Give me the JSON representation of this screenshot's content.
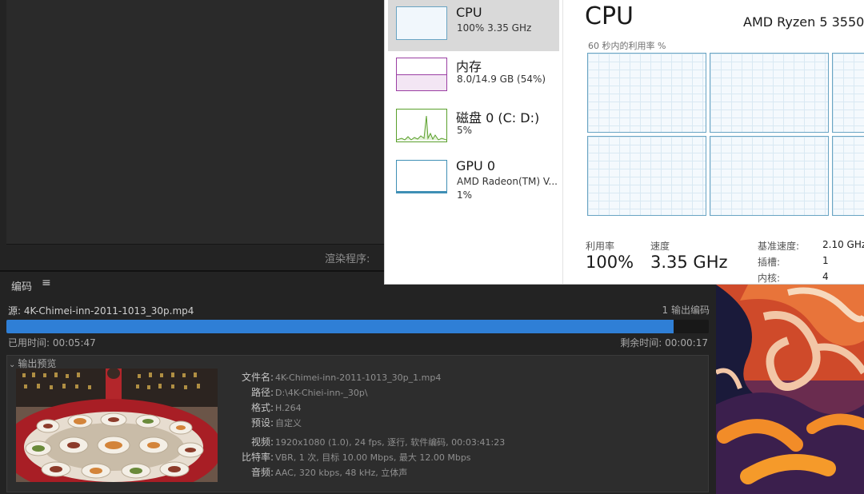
{
  "encoder": {
    "renderer_label": "渲染程序:",
    "panel_title": "编码",
    "menu_icon": "≡",
    "source": "源: 4K-Chimei-inn-2011-1013_30p.mp4",
    "queue": "1 输出编码",
    "progress_fraction": 0.95,
    "elapsed": "已用时间: 00:05:47",
    "remaining": "剩余时间: 00:00:17",
    "preview_header": "输出预览",
    "details": {
      "filename_label": "文件名:",
      "filename": "4K-Chimei-inn-2011-1013_30p_1.mp4",
      "path_label": "路径:",
      "path": "D:\\4K-Chiei-inn-_30p\\",
      "format_label": "格式:",
      "format": "H.264",
      "preset_label": "预设:",
      "preset": "自定义",
      "video_label": "视频:",
      "video": "1920x1080 (1.0), 24 fps, 逐行, 软件编码, 00:03:41:23",
      "bitrate_label": "比特率:",
      "bitrate": "VBR, 1 次, 目标 10.00 Mbps, 最大 12.00 Mbps",
      "audio_label": "音频:",
      "audio": "AAC, 320 kbps, 48 kHz, 立体声"
    }
  },
  "task_manager": {
    "sidebar": [
      {
        "name": "CPU",
        "sub1": "100%  3.35 GHz",
        "sub2": ""
      },
      {
        "name": "内存",
        "sub1": "8.0/14.9 GB (54%)",
        "sub2": ""
      },
      {
        "name": "磁盘 0 (C: D:)",
        "sub1": "5%",
        "sub2": ""
      },
      {
        "name": "GPU 0",
        "sub1": "AMD Radeon(TM) V...",
        "sub2": "1%"
      }
    ],
    "title": "CPU",
    "model": "AMD Ryzen 5 3550",
    "graph_label": "60 秒内的利用率 %",
    "utilization_label": "利用率",
    "utilization_value": "100%",
    "speed_label": "速度",
    "speed_value": "3.35 GHz",
    "base_speed_label": "基准速度:",
    "base_speed_value": "2.10 GHz",
    "sockets_label": "插槽:",
    "sockets_value": "1",
    "cores_label": "内核:",
    "cores_value": "4"
  },
  "colors": {
    "progress": "#2f7fd6",
    "cpu_graph": "#69a4c3",
    "memory_graph": "#9b3fa3",
    "disk_graph": "#5aa02c",
    "gpu_graph": "#3f8fb5"
  }
}
